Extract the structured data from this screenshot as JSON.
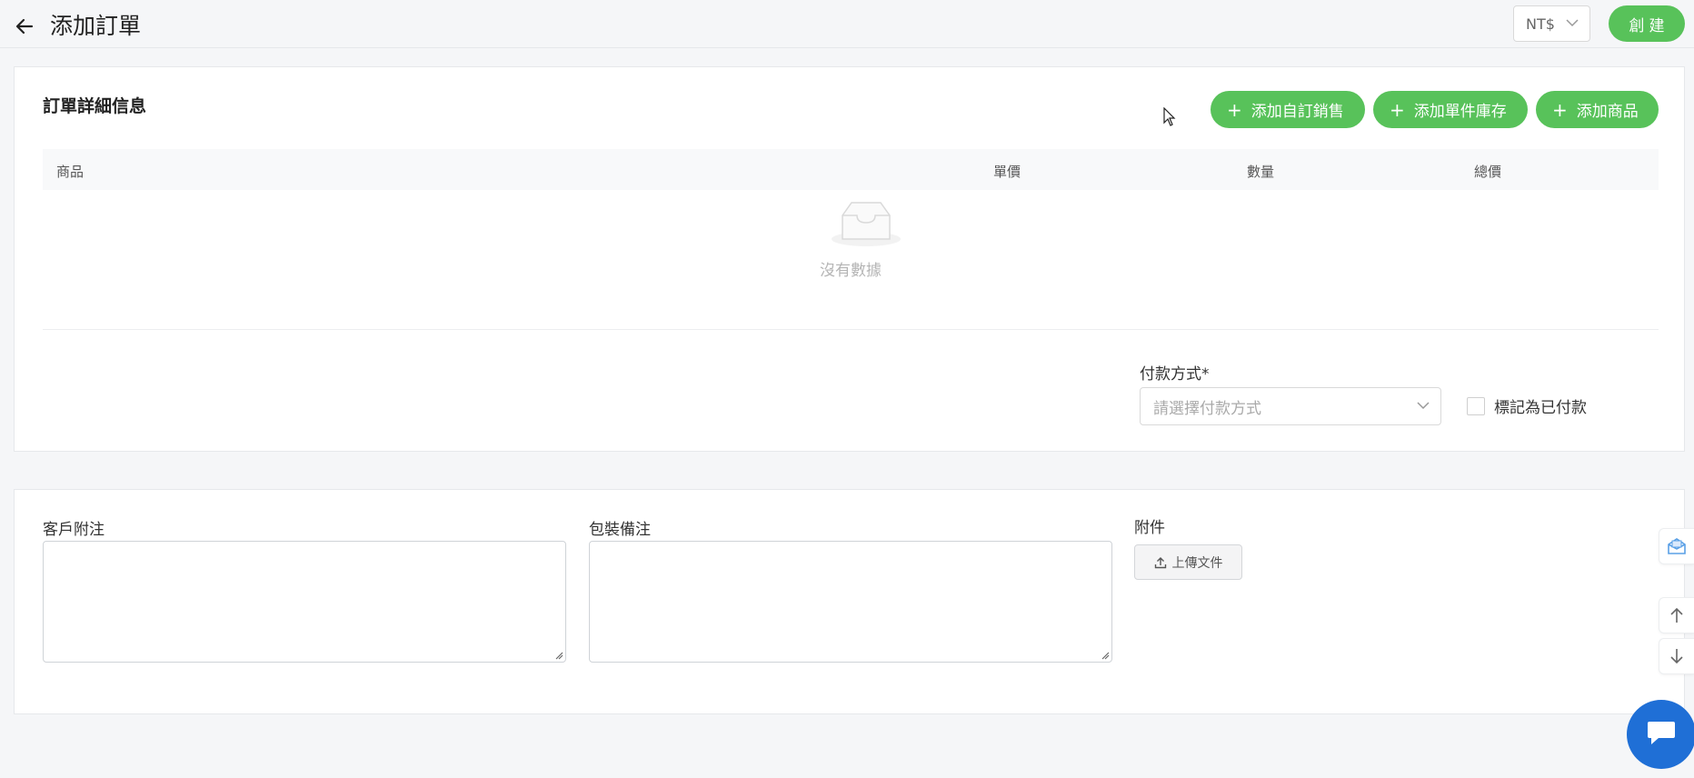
{
  "header": {
    "title": "添加訂單",
    "currency": "NT$",
    "create_label": "創建"
  },
  "order_details": {
    "section_title": "訂單詳細信息",
    "buttons": {
      "add_custom_sale": "添加自訂銷售",
      "add_single_stock": "添加單件庫存",
      "add_product": "添加商品"
    },
    "table": {
      "columns": [
        "商品",
        "單價",
        "數量",
        "總價"
      ],
      "empty_text": "沒有數據"
    },
    "payment": {
      "label": "付款方式*",
      "placeholder": "請選擇付款方式",
      "mark_paid_label": "標記為已付款",
      "mark_paid_checked": false
    }
  },
  "notes": {
    "customer_note_label": "客戶附注",
    "customer_note_value": "",
    "packing_note_label": "包裝備注",
    "packing_note_value": "",
    "attachment_label": "附件",
    "upload_label": "上傳文件"
  },
  "icons": {
    "back": "arrow-left-icon",
    "plus": "plus-icon",
    "chevron": "chevron-down-icon",
    "empty": "inbox-icon",
    "upload": "upload-icon",
    "mail": "mail-icon",
    "up": "arrow-up-icon",
    "down": "arrow-down-icon",
    "chat": "chat-icon"
  },
  "colors": {
    "primary_green": "#58c25a",
    "chat_blue": "#1f6fd6"
  }
}
